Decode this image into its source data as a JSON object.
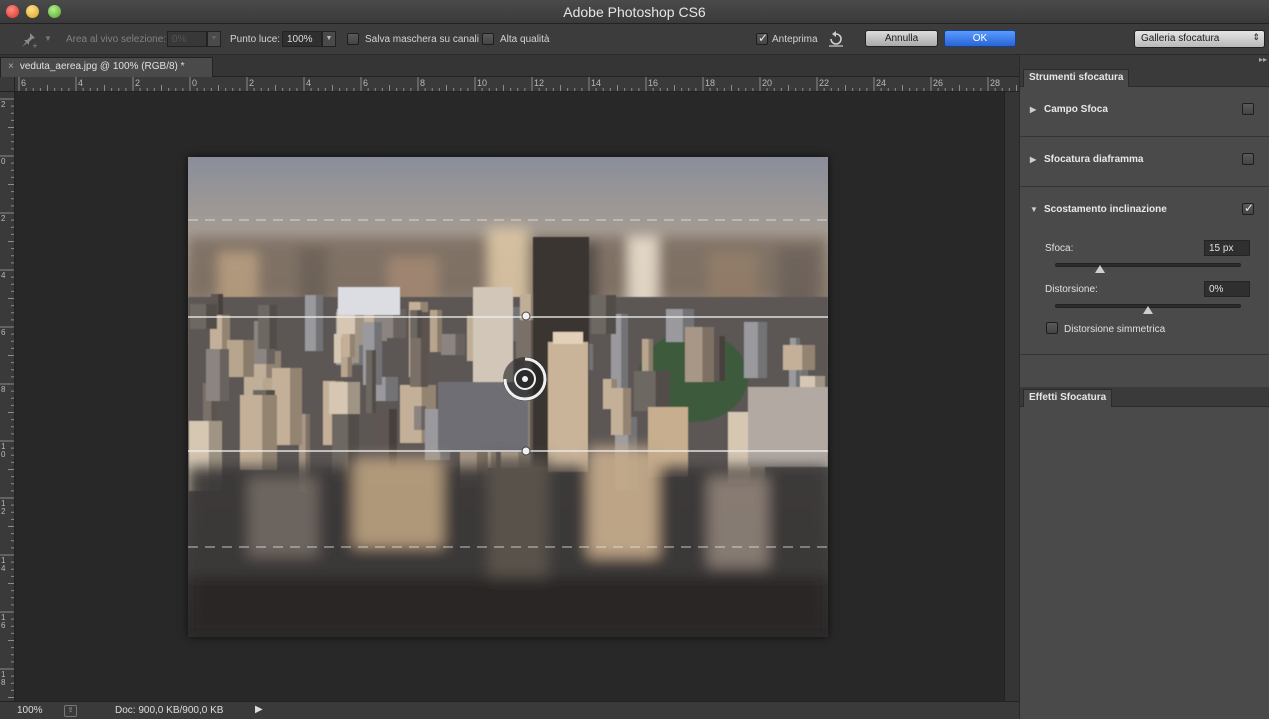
{
  "window": {
    "title": "Adobe Photoshop CS6"
  },
  "options": {
    "selection_area_label": "Area al vivo selezione:",
    "selection_area_value": "0%",
    "light_point_label": "Punto luce:",
    "light_point_value": "100%",
    "save_mask_label": "Salva maschera su canali",
    "save_mask_checked": false,
    "high_quality_label": "Alta qualità",
    "high_quality_checked": false,
    "preview_label": "Anteprima",
    "preview_checked": true,
    "cancel_label": "Annulla",
    "ok_label": "OK",
    "gallery_select": "Galleria sfocatura"
  },
  "document": {
    "tab_title": "veduta_aerea.jpg @ 100% (RGB/8) *",
    "ruler_top_labels": [
      "6",
      "4",
      "2",
      "0",
      "2",
      "4",
      "6",
      "8",
      "10",
      "12",
      "14",
      "16",
      "18",
      "20",
      "22",
      "24",
      "26",
      "28"
    ],
    "ruler_left_labels": [
      "2",
      "0",
      "2",
      "4",
      "6",
      "8",
      "1 0",
      "1 2",
      "1 4",
      "1 6",
      "1 8"
    ]
  },
  "status": {
    "zoom": "100%",
    "doc_info": "Doc: 900,0 KB/900,0 KB"
  },
  "panel": {
    "tools_tab": "Strumenti sfocatura",
    "field_blur": {
      "label": "Campo Sfoca",
      "checked": false
    },
    "iris_blur": {
      "label": "Sfocatura diaframma",
      "checked": false
    },
    "tilt_shift": {
      "label": "Scostamento inclinazione",
      "checked": true,
      "blur_label": "Sfoca:",
      "blur_value": "15 px",
      "blur_level": 0.24,
      "distortion_label": "Distorsione:",
      "distortion_value": "0%",
      "distortion_level": 0.5,
      "symmetric_label": "Distorsione simmetrica",
      "symmetric_checked": false
    },
    "effects_tab": "Effetti Sfocatura"
  },
  "colors": {
    "accent_button": "#2f6fe0",
    "panel_bg": "#4a4a4a",
    "canvas_bg": "#282828"
  }
}
